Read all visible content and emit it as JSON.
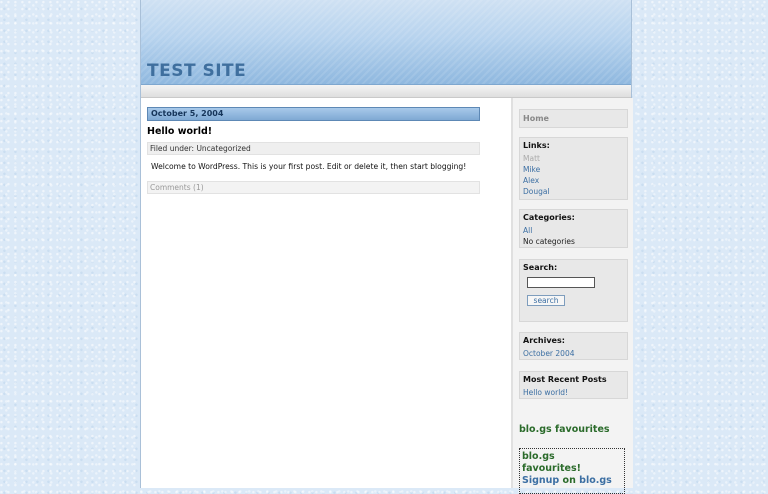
{
  "site": {
    "title": "TEST SITE"
  },
  "post": {
    "date": "October 5, 2004",
    "title": "Hello world!",
    "filed_under": "Filed under: Uncategorized",
    "body": "Welcome to WordPress. This is your first post. Edit or delete it, then start blogging!",
    "comments": "Comments (1)"
  },
  "sidebar": {
    "home": "Home",
    "links": {
      "heading": "Links:",
      "items": [
        "Matt",
        "Mike",
        "Alex",
        "Dougal"
      ]
    },
    "categories": {
      "heading": "Categories:",
      "all": "All",
      "none": "No categories"
    },
    "search": {
      "heading": "Search:",
      "value": "",
      "button": "search"
    },
    "archives": {
      "heading": "Archives:",
      "items": [
        "October 2004"
      ]
    },
    "recent": {
      "heading": "Most Recent Posts",
      "items": [
        "Hello world!"
      ]
    },
    "blogs": {
      "title": "blo.gs favourites",
      "box_line1": "blo.gs",
      "box_line2": "favourites!",
      "signup": "Signup",
      "on": "on",
      "site": "blo.gs"
    }
  }
}
